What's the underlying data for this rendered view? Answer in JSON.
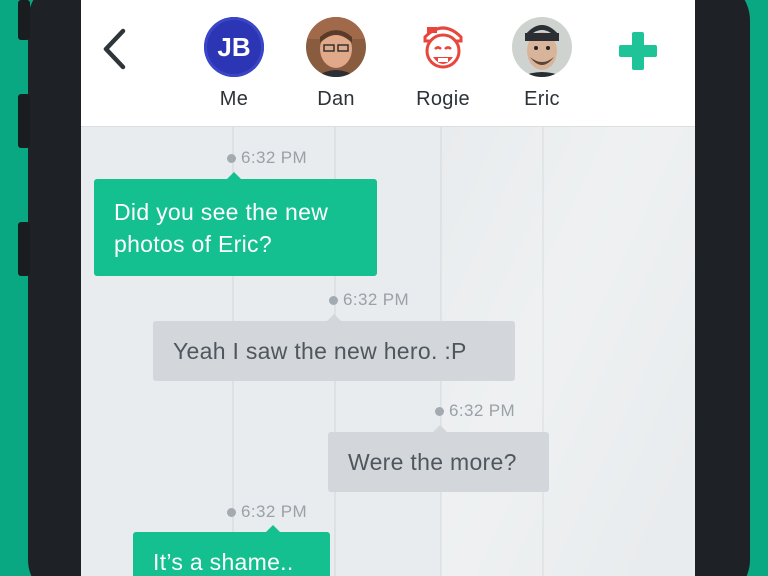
{
  "header": {
    "contacts": [
      {
        "name": "Me",
        "initials": "JB"
      },
      {
        "name": "Dan"
      },
      {
        "name": "Rogie"
      },
      {
        "name": "Eric"
      }
    ],
    "icons": {
      "back": "chevron-left-icon",
      "add": "plus-icon"
    },
    "colors": {
      "accent": "#1ec397",
      "me_avatar": "#2c36b4",
      "rogie": "#e8463c"
    }
  },
  "messages": [
    {
      "time": "6:32 PM",
      "text": "Did you see the new photos of Eric?",
      "sender": "Me"
    },
    {
      "time": "6:32 PM",
      "text": "Yeah I saw the new hero. :P",
      "sender": "Dan"
    },
    {
      "time": "6:32 PM",
      "text": "Were the more?",
      "sender": "Rogie"
    },
    {
      "time": "6:32 PM",
      "text": "It’s a shame..",
      "sender": "Me"
    }
  ],
  "colors": {
    "background": "#0aa882",
    "bubble_self": "#14bf90",
    "bubble_other": "#d3d7db"
  }
}
